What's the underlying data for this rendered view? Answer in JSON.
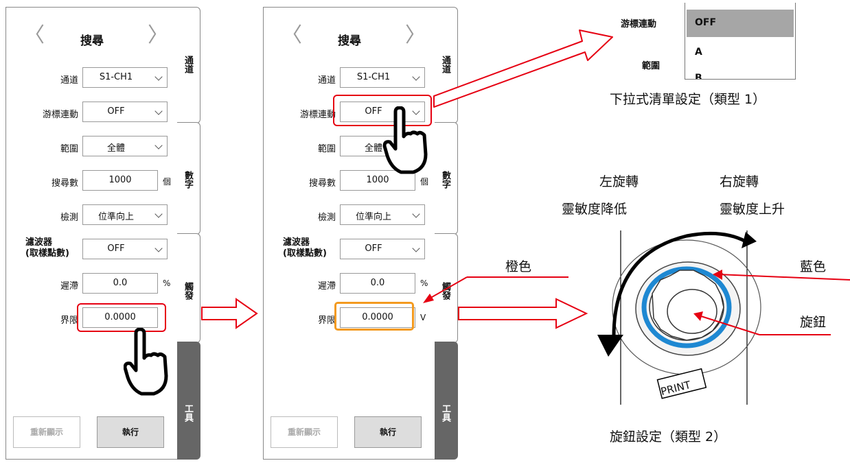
{
  "panel": {
    "title": "搜尋",
    "prev_arrow": "〈",
    "next_arrow": "〉",
    "fields": {
      "channel": {
        "label": "通道",
        "value": "S1-CH1"
      },
      "cursor_link": {
        "label": "游標連動",
        "value": "OFF"
      },
      "range": {
        "label": "範圍",
        "value": "全體"
      },
      "search_count": {
        "label": "搜尋數",
        "value": "1000",
        "unit": "個"
      },
      "detection": {
        "label": "檢測",
        "value": "位準向上"
      },
      "filter": {
        "label_line1": "濾波器",
        "label_line2": "(取樣點數)",
        "value": "OFF"
      },
      "hysteresis": {
        "label": "遲滯",
        "value": "0.0",
        "unit": "%"
      },
      "limit": {
        "label": "界限",
        "value": "0.0000",
        "unit": "V"
      }
    },
    "tabs": [
      "通道",
      "數字",
      "觸發",
      "工具"
    ],
    "redisplay_label": "重新顯示",
    "execute_label": "執行"
  },
  "dropdown": {
    "field_label": "游標連動",
    "range_label": "範圍",
    "options": [
      "OFF",
      "A",
      "B"
    ],
    "caption": "下拉式清單設定（類型 1）"
  },
  "knob": {
    "left_turn": "左旋轉",
    "left_effect": "靈敏度降低",
    "right_turn": "右旋轉",
    "right_effect": "靈敏度上升",
    "orange_label": "橙色",
    "blue_label": "藍色",
    "knob_label": "旋鈕",
    "print_label": "PRINT",
    "caption": "旋鈕設定（類型 2）"
  },
  "colors": {
    "highlight_red": "#e60012",
    "orange": "#f39a1f",
    "blue": "#1e88d2",
    "tab_dark": "#666666"
  },
  "icons": [
    "hand-pointer-icon",
    "arrow-right-icon",
    "chevron-down-icon"
  ]
}
